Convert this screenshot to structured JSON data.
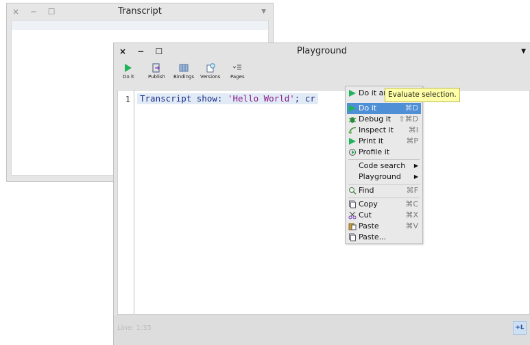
{
  "transcript": {
    "title": "Transcript",
    "controls": "× − ☐",
    "menu_arrow": "▼"
  },
  "playground": {
    "title": "Playground",
    "controls": "× − ☐",
    "menu_arrow": "▼",
    "toolbar": {
      "doit_label": "Do it",
      "publish_label": "Publish",
      "bindings_label": "Bindings",
      "versions_label": "Versions",
      "pages_label": "Pages"
    },
    "editor": {
      "line_number": "1",
      "code": {
        "part1": "Transcript show: ",
        "string": "'Hello World'",
        "part2": "; cr"
      }
    },
    "status": {
      "position": "Line: 1:35",
      "button": "+L"
    }
  },
  "context_menu": {
    "items": [
      {
        "label": "Do it and go",
        "shortcut": "",
        "icon": "play-icon"
      },
      {
        "label": "Do it",
        "shortcut": "⌘D",
        "icon": "play-icon",
        "selected": true
      },
      {
        "label": "Debug it",
        "shortcut": "⇧⌘D",
        "icon": "bug-icon"
      },
      {
        "label": "Inspect it",
        "shortcut": "⌘I",
        "icon": "inspect-icon"
      },
      {
        "label": "Print it",
        "shortcut": "⌘P",
        "icon": "play-icon"
      },
      {
        "label": "Profile it",
        "shortcut": "",
        "icon": "profile-icon"
      },
      {
        "label": "Code search",
        "shortcut": "▶",
        "icon": ""
      },
      {
        "label": "Playground",
        "shortcut": "▶",
        "icon": ""
      },
      {
        "label": "Find",
        "shortcut": "⌘F",
        "icon": "find-icon"
      },
      {
        "label": "Copy",
        "shortcut": "⌘C",
        "icon": "copy-icon"
      },
      {
        "label": "Cut",
        "shortcut": "⌘X",
        "icon": "cut-icon"
      },
      {
        "label": "Paste",
        "shortcut": "⌘V",
        "icon": "paste-icon"
      },
      {
        "label": "Paste...",
        "shortcut": "",
        "icon": "paste-icon"
      }
    ],
    "tooltip": "Evaluate selection."
  },
  "colors": {
    "selection": "#4f8fd6",
    "tooltip_bg": "#ffffa8",
    "play_green": "#1fb35a",
    "code_blue": "#1a2b8c",
    "string_purple": "#8a1c8a"
  }
}
